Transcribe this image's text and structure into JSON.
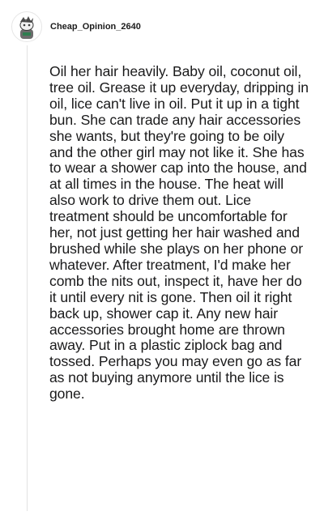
{
  "post": {
    "author": "Cheap_Opinion_2640",
    "avatar_icon": "snoo-avatar-icon",
    "body": "Oil her hair heavily. Baby oil, coconut oil, tree oil. Grease it up everyday, dripping in oil, lice can't live in oil. Put it up in a tight bun. She can trade any hair accessories she wants, but they're going to be oily and the other girl may not like it. She has to wear a shower cap into the house, and at all times in the house. The heat will also work to drive them out. Lice treatment should be uncomfortable for her, not just getting her hair washed and brushed while she plays on her phone or whatever. After treatment, I'd make her comb the nits out, inspect it, have her do it until every nit is gone. Then oil it right back up, shower cap it. Any new hair accessories brought home are thrown away. Put in a plastic ziplock bag and tossed. Perhaps you may even go as far as not buying anymore until the lice is gone."
  }
}
